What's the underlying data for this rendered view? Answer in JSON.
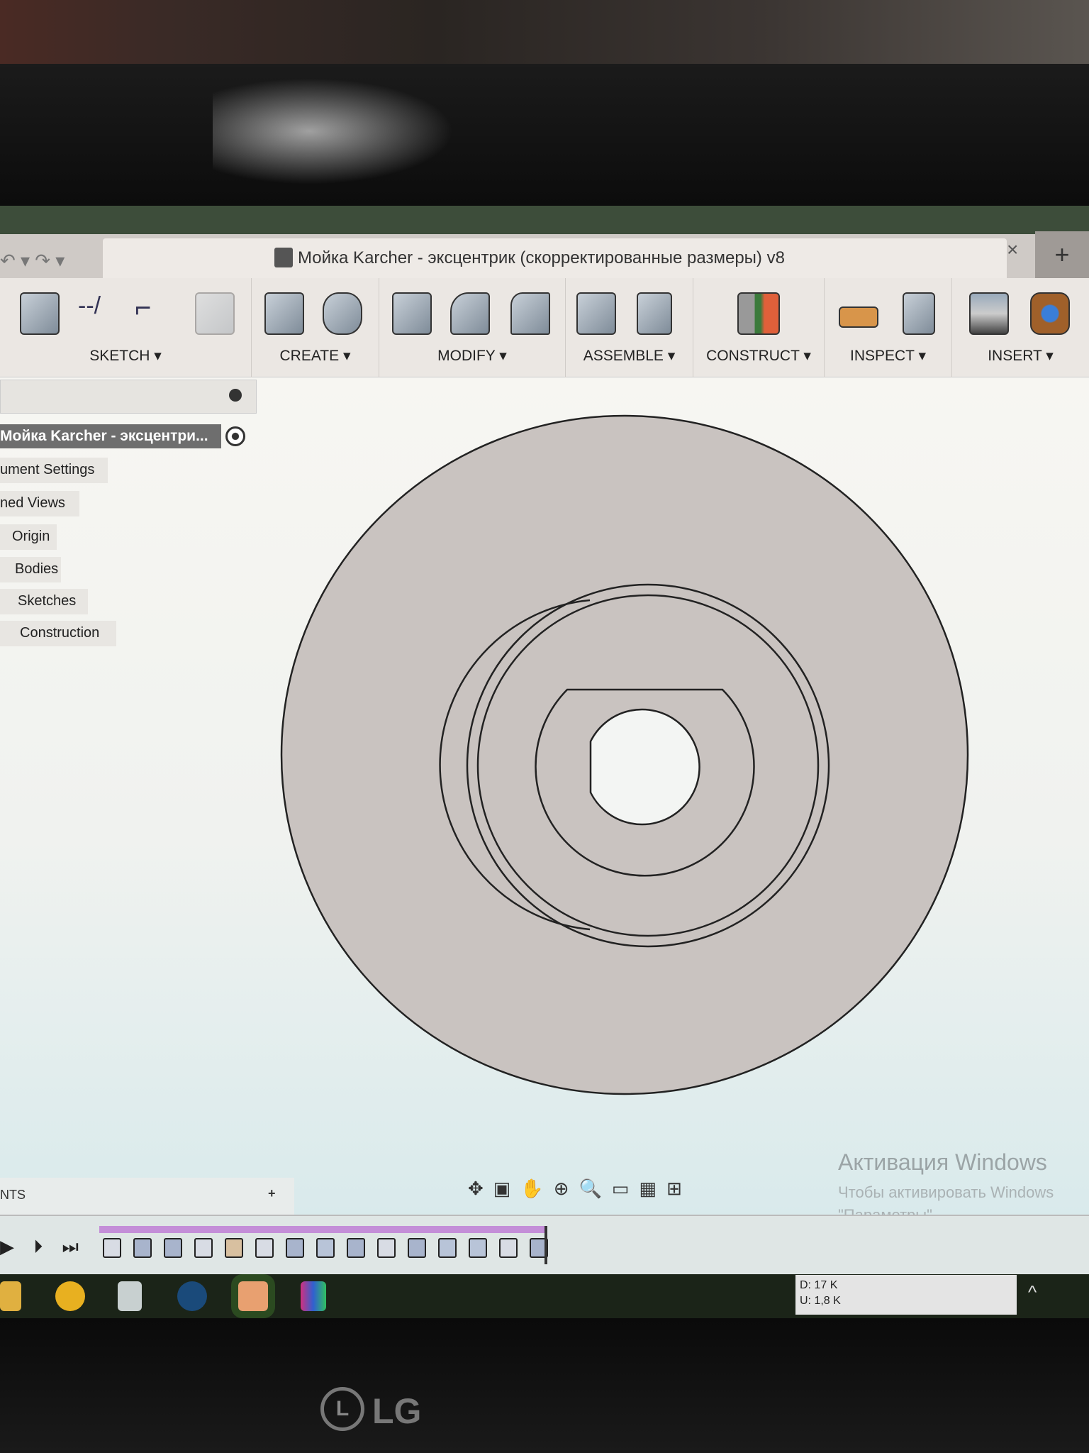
{
  "window": {
    "title": "Мойка Karcher - эксцентрик (скорректированные размеры) v8",
    "close": "×",
    "new_tab": "+",
    "undo": "↶ ▾ ↷ ▾"
  },
  "toolbar": {
    "groups": [
      {
        "label": "SKETCH ▾",
        "tools": [
          "create-sketch",
          "line",
          "fillet-sketch",
          "mirror"
        ]
      },
      {
        "label": "CREATE ▾",
        "tools": [
          "extrude",
          "revolve"
        ]
      },
      {
        "label": "MODIFY ▾",
        "tools": [
          "press-pull",
          "fillet",
          "chamfer"
        ]
      },
      {
        "label": "ASSEMBLE ▾",
        "tools": [
          "new-component",
          "joint"
        ]
      },
      {
        "label": "CONSTRUCT ▾",
        "tools": [
          "offset-plane"
        ]
      },
      {
        "label": "INSPECT ▾",
        "tools": [
          "measure",
          "section-analysis"
        ]
      },
      {
        "label": "INSERT ▾",
        "tools": [
          "insert-canvas",
          "insert-mesh"
        ]
      }
    ]
  },
  "browser": {
    "root": "Мойка Karcher - эксцентри...",
    "items": [
      "ument Settings",
      "ned Views",
      "Origin",
      "Bodies",
      "Sketches",
      "Construction"
    ]
  },
  "comments": {
    "label": "NTS",
    "add": "+"
  },
  "navbar": {
    "icons": [
      "orbit-icon",
      "look-at-icon",
      "pan-icon",
      "zoom-icon",
      "fit-icon",
      "display-settings-icon",
      "grid-icon",
      "viewports-icon"
    ]
  },
  "watermark": {
    "line1": "Активация Windows",
    "line2": "Чтобы активировать Windows",
    "line3": "\"Параметры\"."
  },
  "timeline": {
    "playback": "▶ ⏵ ⏭",
    "features": [
      "sketch",
      "extrude",
      "extrude",
      "sketch",
      "loft",
      "sketch",
      "extrude",
      "chamfer",
      "extrude",
      "sketch",
      "extrude",
      "chamfer",
      "fillet",
      "sketch",
      "extrude"
    ]
  },
  "taskbar": {
    "apps": [
      "file-explorer",
      "autocad",
      "calculator",
      "steam",
      "fusion-360",
      "app"
    ],
    "net_down": "D: 17 K",
    "net_up": "U: 1,8 K",
    "tray": "^"
  },
  "monitor": {
    "brand": "LG"
  },
  "colors": {
    "timeline_bar": "#c48ed8",
    "body": "#c9c3c0",
    "viewport_top": "#f7f6f2",
    "viewport_bottom": "#d9eaec"
  }
}
